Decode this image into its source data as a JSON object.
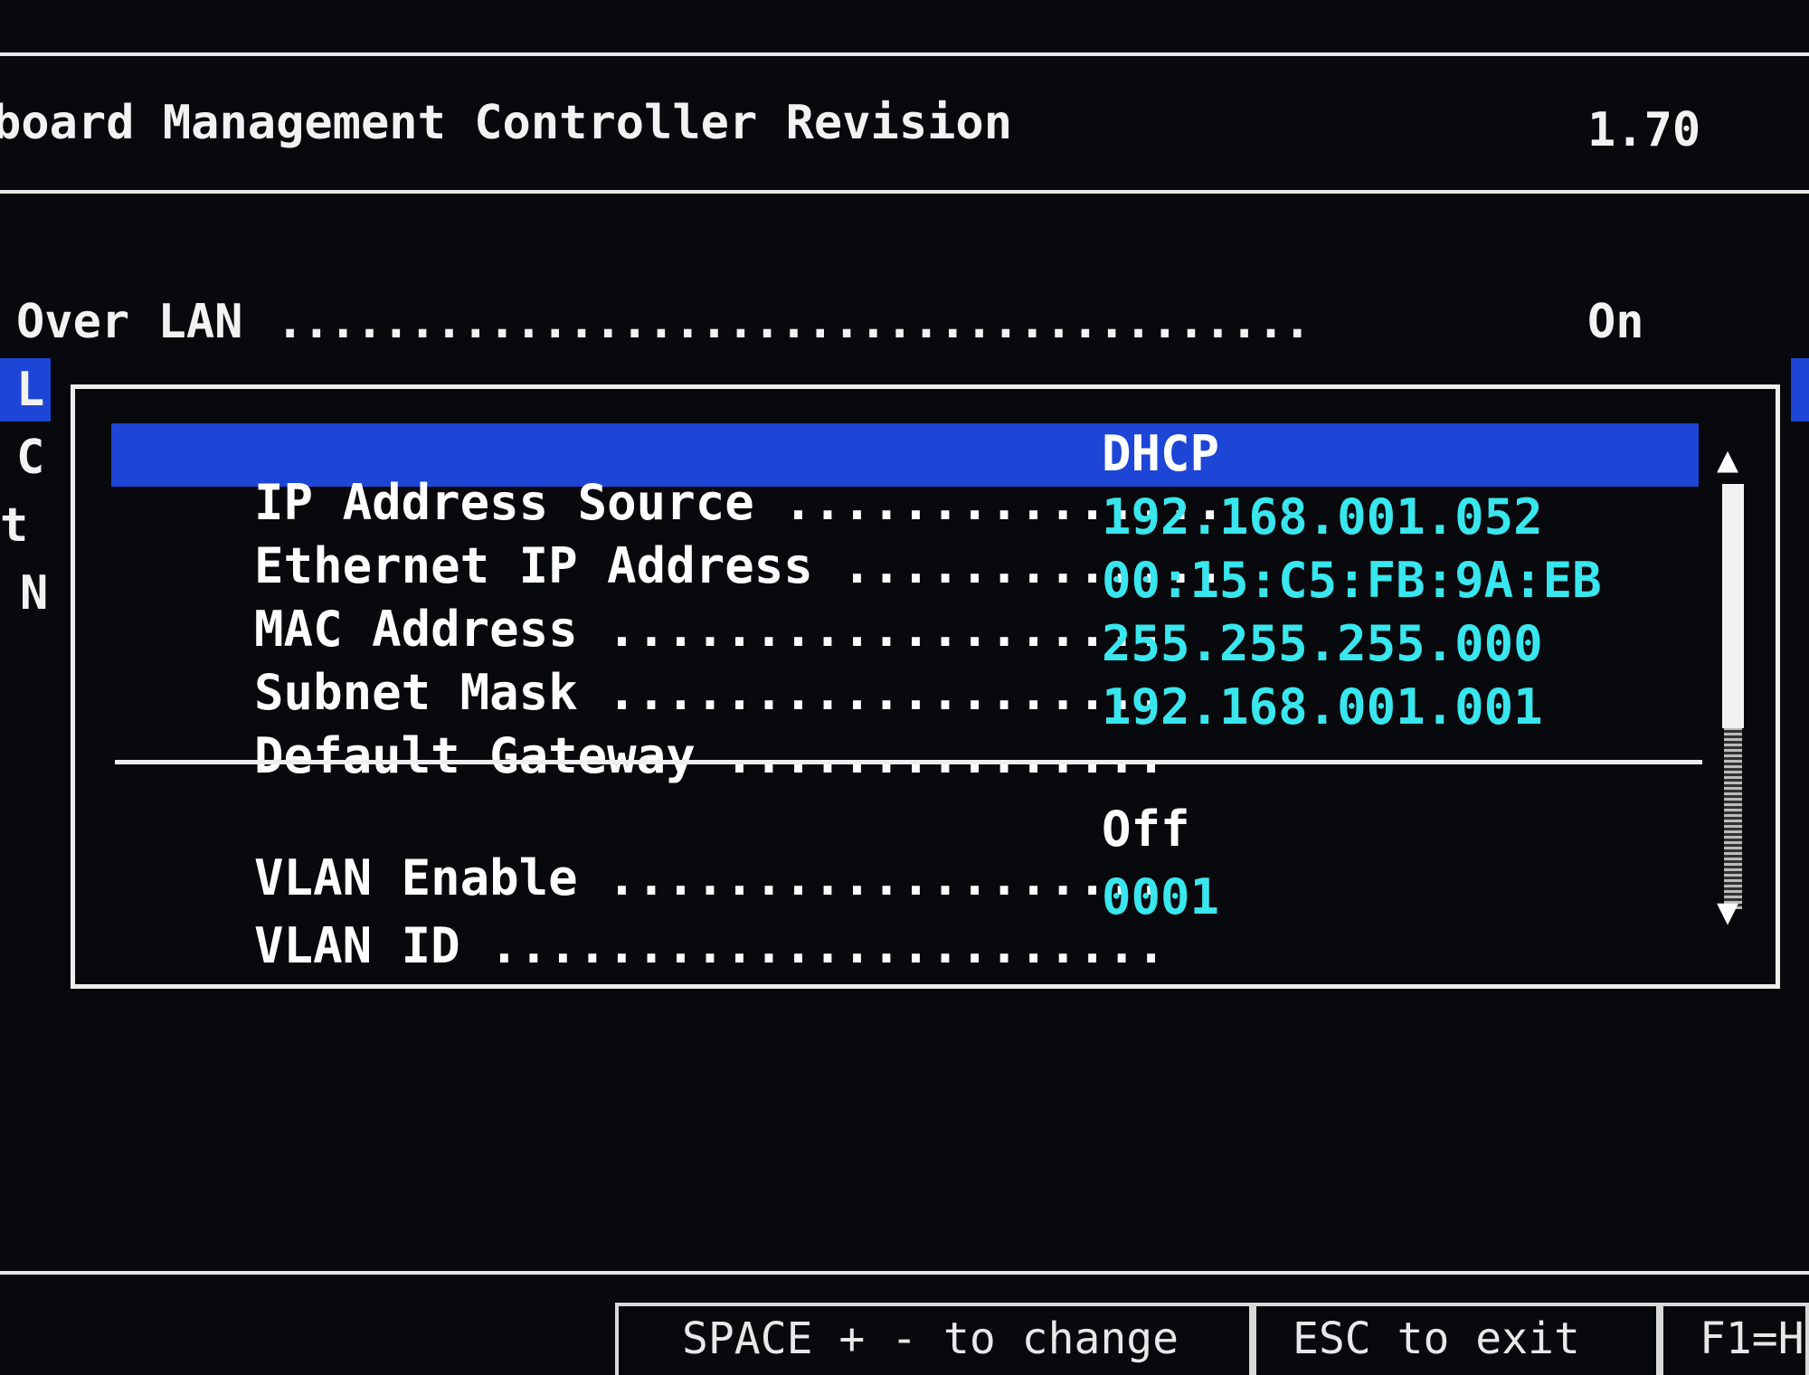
{
  "header": {
    "title": "board Management Controller Revision",
    "revision": "1.70"
  },
  "background_menu": {
    "serial_over_lan_label": "Over LAN",
    "serial_over_lan_dots": ".......................................",
    "serial_over_lan_value": "On",
    "left_letters": [
      "L",
      "C",
      "t",
      "N"
    ]
  },
  "popup": {
    "rows": [
      {
        "label": "IP Address Source",
        "dots": "...............",
        "value": "DHCP",
        "selected": true
      },
      {
        "label": "Ethernet IP Address",
        "dots": ".............",
        "value": "192.168.001.052"
      },
      {
        "label": "MAC Address",
        "dots": "...................",
        "value": "00:15:C5:FB:9A:EB"
      },
      {
        "label": "Subnet Mask",
        "dots": "...................",
        "value": "255.255.255.000"
      },
      {
        "label": "Default Gateway",
        "dots": "...............",
        "value": "192.168.001.001"
      },
      {
        "label": "VLAN Enable",
        "dots": "...................",
        "value": "Off"
      },
      {
        "label": "VLAN ID",
        "dots": ".......................",
        "value": "0001"
      }
    ]
  },
  "footer": {
    "space_hint": "SPACE + - to change",
    "esc_hint": "ESC to exit",
    "f1_hint": "F1=H"
  },
  "colors": {
    "background": "#08090c",
    "highlight": "#1d45d6",
    "value_cyan": "#38e6ee",
    "text": "#f2f2f2"
  }
}
